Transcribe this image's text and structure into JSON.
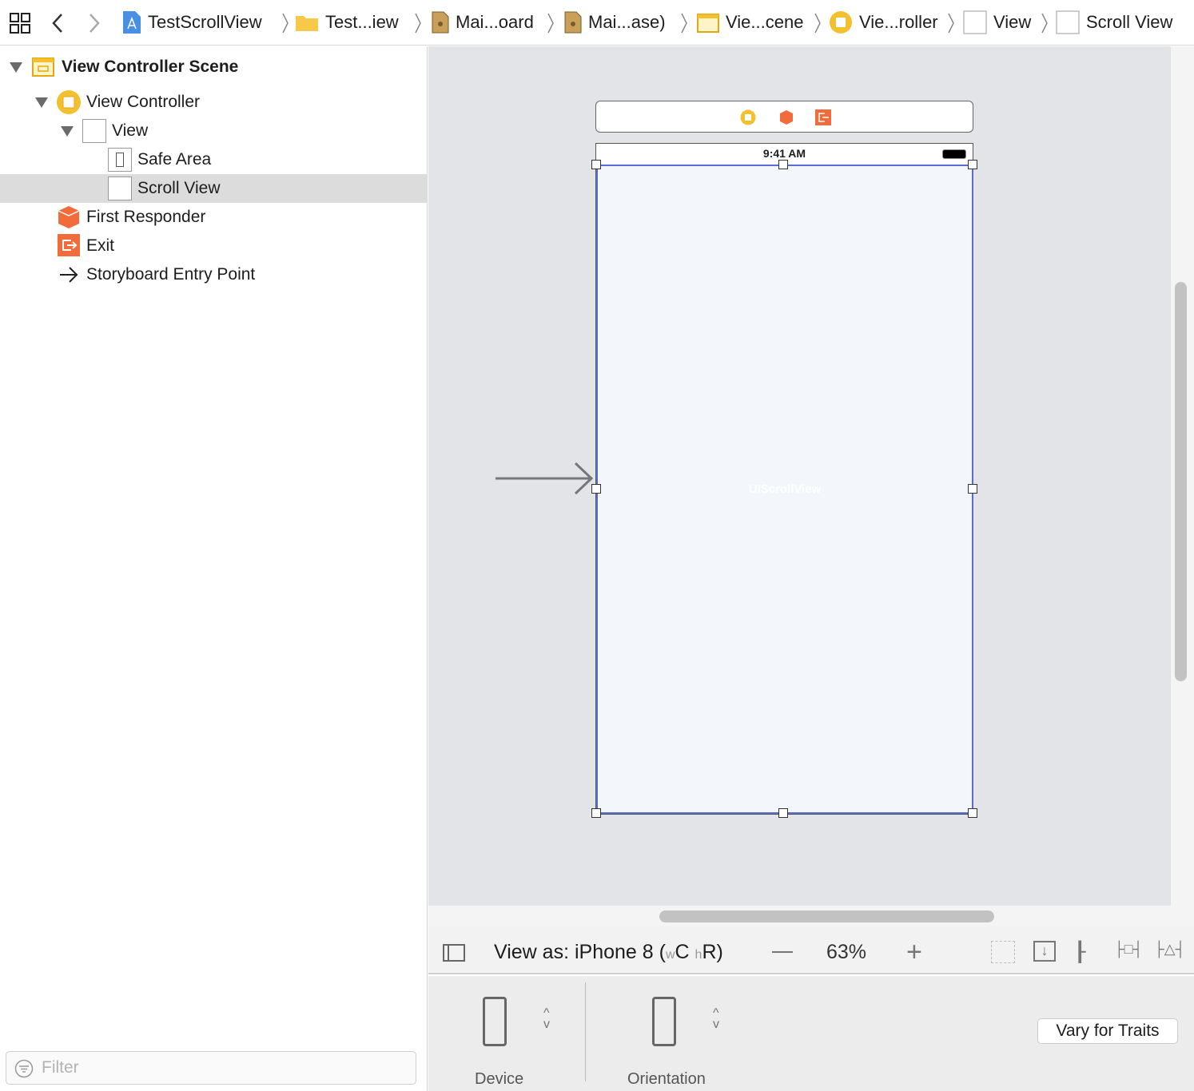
{
  "toolbar": {
    "breadcrumbs": [
      {
        "label": "TestScrollView",
        "icon": "xcode-project-icon"
      },
      {
        "label": "Test...iew",
        "icon": "folder-icon"
      },
      {
        "label": "Mai...oard",
        "icon": "storyboard-file-icon"
      },
      {
        "label": "Mai...ase)",
        "icon": "storyboard-file-icon"
      },
      {
        "label": "Vie...cene",
        "icon": "scene-icon"
      },
      {
        "label": "Vie...roller",
        "icon": "view-controller-icon"
      },
      {
        "label": "View",
        "icon": "view-icon"
      },
      {
        "label": "Scroll View",
        "icon": "view-icon"
      }
    ]
  },
  "outline": {
    "items": [
      {
        "label": "View Controller Scene"
      },
      {
        "label": "View Controller"
      },
      {
        "label": "View"
      },
      {
        "label": "Safe Area"
      },
      {
        "label": "Scroll View"
      },
      {
        "label": "First Responder"
      },
      {
        "label": "Exit"
      },
      {
        "label": "Storyboard Entry Point"
      }
    ],
    "filter_placeholder": "Filter"
  },
  "canvas": {
    "status_time": "9:41 AM",
    "scroll_view_label": "UIScrollView"
  },
  "bottombar": {
    "view_as": "View as: iPhone 8 (",
    "w": "w",
    "c": "C",
    "h": "h",
    "r": "R)",
    "zoom": "63%"
  },
  "panel": {
    "device_label": "Device",
    "orientation_label": "Orientation",
    "vary_button": "Vary for Traits"
  },
  "colors": {
    "selection": "#5b6bd6",
    "scene_yellow": "#f5c02e",
    "responder_orange": "#f26b3a"
  }
}
